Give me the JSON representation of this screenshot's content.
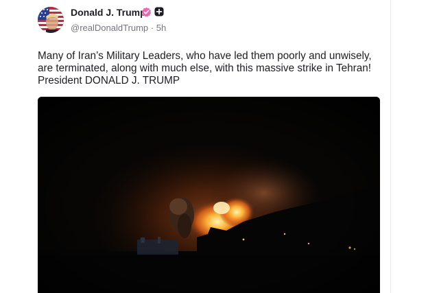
{
  "post": {
    "author": {
      "display_name": "Donald J. Trump",
      "handle": "@realDonaldTrump",
      "separator": "·",
      "time_ago": "5h",
      "avatar_icon": "flag-portrait-avatar",
      "verified_icon": "verified-badge-icon",
      "extra_icon": "plus-square-icon"
    },
    "body_text": "Many of Iran’s Military Leaders, who have led them poorly and unwisely,\nare terminated, along with much else, with this massive strike in Tehran!\nPresident DONALD J. TRUMP",
    "media": {
      "type": "video-frame",
      "description_icon": "night-explosion-image"
    }
  },
  "colors": {
    "name_text": "#1d1d23",
    "meta_text": "#74747e",
    "verified_badge": "#e86bb0",
    "media_background": "#060606"
  }
}
